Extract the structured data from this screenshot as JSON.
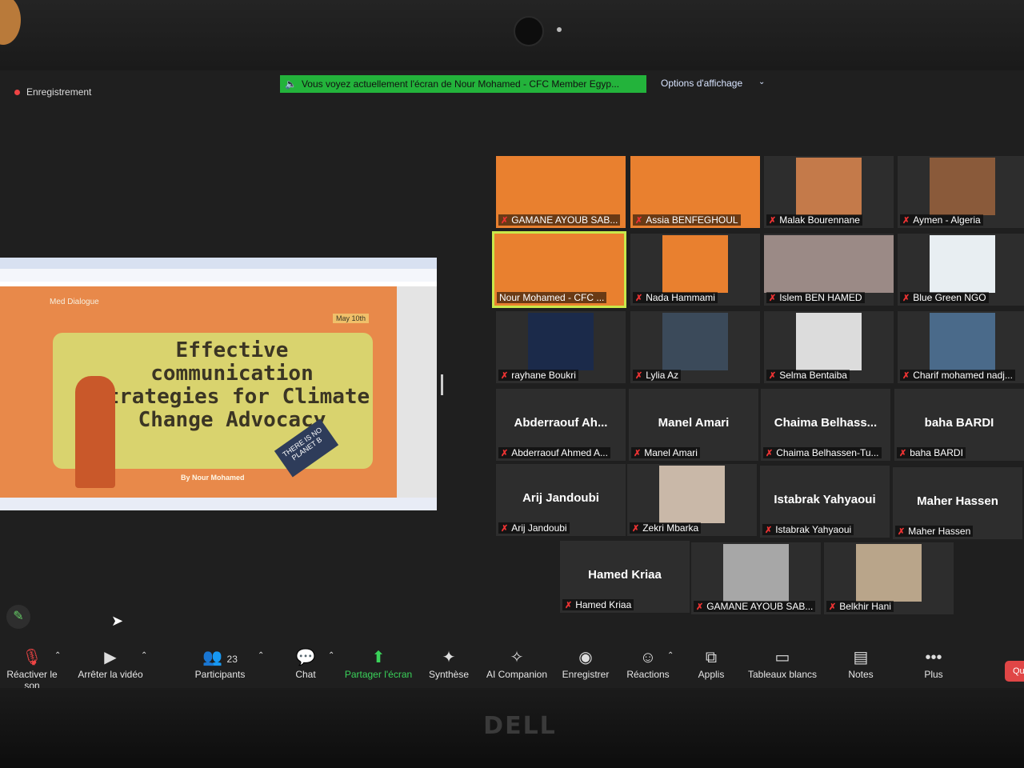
{
  "recording": {
    "label": "Enregistrement"
  },
  "banner": {
    "text": "Vous voyez actuellement l'écran de Nour Mohamed - CFC Member Egyp..."
  },
  "view_options": {
    "label": "Options d'affichage"
  },
  "shared_slide": {
    "logo_text": "Med Dialogue",
    "date": "May 10th",
    "title": "Effective communication strategies for Climate Change Advocacy",
    "sign_text": "THERE IS NO PLANET B",
    "byline": "By Nour Mohamed"
  },
  "participants": [
    {
      "name": "GAMANE AYOUB SAB...",
      "muted": true
    },
    {
      "name": "Assia BENFEGHOUL",
      "muted": true
    },
    {
      "name": "Malak Bourennane",
      "muted": true
    },
    {
      "name": "Aymen - Algeria",
      "muted": true
    },
    {
      "name": "Nour Mohamed - CFC ...",
      "muted": false
    },
    {
      "name": "Nada Hammami",
      "muted": true
    },
    {
      "name": "Islem BEN HAMED",
      "muted": true
    },
    {
      "name": "Blue Green NGO",
      "muted": true
    },
    {
      "name": "rayhane Boukri",
      "muted": true
    },
    {
      "name": "Lylia Az",
      "muted": true
    },
    {
      "name": "Selma Bentaiba",
      "muted": true
    },
    {
      "name": "Charif mohamed nadj...",
      "muted": true
    },
    {
      "name": "Abderraouf Ahmed A...",
      "display": "Abderraouf Ah...",
      "muted": true
    },
    {
      "name": "Manel Amari",
      "display": "Manel Amari",
      "muted": true
    },
    {
      "name": "Chaima Belhassen-Tu...",
      "display": "Chaima Belhass...",
      "muted": true
    },
    {
      "name": "baha BARDI",
      "display": "baha BARDI",
      "muted": true
    },
    {
      "name": "Arij Jandoubi",
      "display": "Arij Jandoubi",
      "muted": true
    },
    {
      "name": "Zekri Mbarka",
      "muted": true
    },
    {
      "name": "Istabrak Yahyaoui",
      "display": "Istabrak Yahyaoui",
      "muted": true
    },
    {
      "name": "Maher Hassen",
      "display": "Maher Hassen",
      "muted": true
    },
    {
      "name": "Hamed Kriaa",
      "display": "Hamed Kriaa",
      "muted": true
    },
    {
      "name": "GAMANE AYOUB SAB...",
      "muted": true
    },
    {
      "name": "Belkhir Hani",
      "muted": true
    }
  ],
  "toolbar": {
    "unmute": "Réactiver le son",
    "stop_video": "Arrêter la vidéo",
    "participants": "Participants",
    "participants_count": "23",
    "chat": "Chat",
    "share": "Partager l'écran",
    "summary": "Synthèse",
    "ai": "AI Companion",
    "record": "Enregistrer",
    "reactions": "Réactions",
    "apps": "Applis",
    "whiteboards": "Tableaux blancs",
    "notes": "Notes",
    "more": "Plus",
    "quit": "Qu"
  },
  "brand": "DELL"
}
